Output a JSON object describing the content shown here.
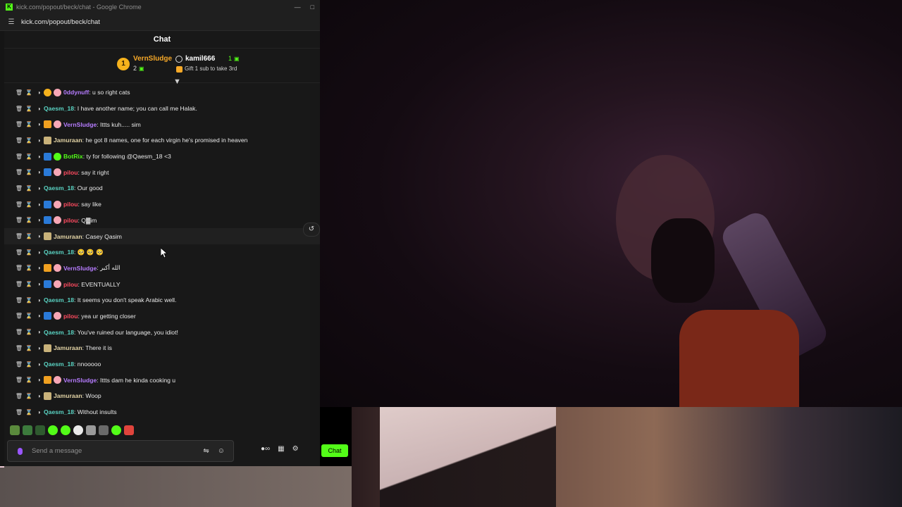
{
  "browser": {
    "title": "kick.com/popout/beck/chat - Google Chrome",
    "url": "kick.com/popout/beck/chat",
    "logo": "K"
  },
  "chat": {
    "header": "Chat",
    "leaderboard": {
      "first": {
        "rank": "1",
        "name": "VernSludge",
        "count": "2"
      },
      "second": {
        "name": "kamil666",
        "count": "1",
        "note": "Gift 1 sub to take 3rd"
      }
    },
    "messages": [
      {
        "badges": [
          "rank",
          "pig"
        ],
        "user": "0ddynuff",
        "color": "purple",
        "text": ": u so right cats"
      },
      {
        "badges": [],
        "user": "Qaesm_18",
        "color": "teal",
        "text": ": I have another name; you can call me Halak."
      },
      {
        "badges": [
          "og",
          "pig"
        ],
        "user": "VernSludge",
        "color": "purple",
        "text": ": Ittts kuh..... sim"
      },
      {
        "badges": [
          "sub"
        ],
        "user": "Jamuraan",
        "color": "tan",
        "text": ": he got 8 names, one for each virgin he's promised in heaven"
      },
      {
        "badges": [
          "vip",
          "bot"
        ],
        "user": "BotRix",
        "color": "green",
        "text": ": ty for following @Qaesm_18 <3"
      },
      {
        "badges": [
          "vip",
          "pig"
        ],
        "user": "pilou",
        "color": "red",
        "text": ": say it right"
      },
      {
        "badges": [],
        "user": "Qaesm_18",
        "color": "teal",
        "text": ": Our good"
      },
      {
        "badges": [
          "vip",
          "pig"
        ],
        "user": "pilou",
        "color": "red",
        "text": ": say like"
      },
      {
        "badges": [
          "vip",
          "pig"
        ],
        "user": "pilou",
        "color": "red",
        "text": ": Q▓im"
      },
      {
        "badges": [
          "sub"
        ],
        "user": "Jamuraan",
        "color": "tan",
        "text": ": Casey Qasim"
      },
      {
        "badges": [],
        "user": "Qaesm_18",
        "color": "teal",
        "text": ": 🥺 🥺 🥺"
      },
      {
        "badges": [
          "og",
          "pig"
        ],
        "user": "VernSludge",
        "color": "purple",
        "text": ": الله أكبر"
      },
      {
        "badges": [
          "vip",
          "pig"
        ],
        "user": "pilou",
        "color": "red",
        "text": ": EVENTUALLY"
      },
      {
        "badges": [],
        "user": "Qaesm_18",
        "color": "teal",
        "text": ": It seems you don't speak Arabic well."
      },
      {
        "badges": [
          "vip",
          "pig"
        ],
        "user": "pilou",
        "color": "red",
        "text": ": yea ur getting closer"
      },
      {
        "badges": [],
        "user": "Qaesm_18",
        "color": "teal",
        "text": ": You've ruined our language, you idiot!"
      },
      {
        "badges": [
          "sub"
        ],
        "user": "Jamuraan",
        "color": "tan",
        "text": ": There it is"
      },
      {
        "badges": [],
        "user": "Qaesm_18",
        "color": "teal",
        "text": ": nnooooo"
      },
      {
        "badges": [
          "og",
          "pig"
        ],
        "user": "VernSludge",
        "color": "purple",
        "text": ": Ittts dam he kinda cooking u"
      },
      {
        "badges": [
          "sub"
        ],
        "user": "Jamuraan",
        "color": "tan",
        "text": ": Woop"
      },
      {
        "badges": [],
        "user": "Qaesm_18",
        "color": "teal",
        "text": ": Without insults"
      }
    ],
    "input": {
      "placeholder": "Send a message"
    },
    "send_label": "Chat"
  },
  "colors": {
    "accent": "#53fc18",
    "background": "#181818",
    "purple": "#b67cff",
    "teal": "#5ad3c3",
    "tan": "#e2d3a5",
    "red": "#ff4b60"
  },
  "icons": [
    "tune-icon",
    "gift-icon",
    "collapse-icon",
    "trash-icon",
    "timeout-icon",
    "shield-icon",
    "mic-icon",
    "translate-icon",
    "emoji-icon",
    "loop-icon",
    "store-icon",
    "gear-icon",
    "rewind-icon"
  ]
}
